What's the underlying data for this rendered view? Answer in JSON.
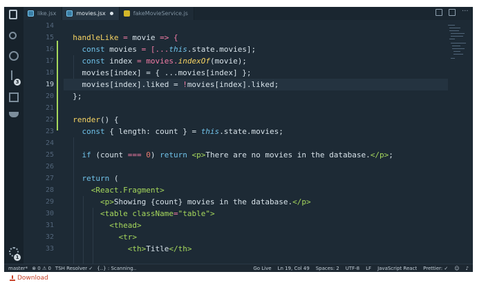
{
  "tabs": [
    {
      "label": "like.jsx",
      "icon": "react-icon"
    },
    {
      "label": "movies.jsx",
      "icon": "react-icon",
      "active": true,
      "modified": true
    },
    {
      "label": "fakeMovieService.js",
      "icon": "js-icon"
    }
  ],
  "activity_badges": {
    "git": "3",
    "settings": "1"
  },
  "lines": [
    {
      "n": "14",
      "cur": false,
      "seg": []
    },
    {
      "n": "15",
      "cur": false,
      "seg": [
        [
          "  handleLike",
          "fn"
        ],
        [
          " = ",
          "op"
        ],
        [
          "movie",
          "param"
        ],
        [
          " => {",
          "op"
        ]
      ]
    },
    {
      "n": "16",
      "cur": false,
      "seg": [
        [
          "    const ",
          "kw"
        ],
        [
          "movies",
          "var"
        ],
        [
          " = [...",
          "op"
        ],
        [
          "this",
          "this"
        ],
        [
          ".state.movies];",
          "var"
        ]
      ]
    },
    {
      "n": "17",
      "cur": false,
      "seg": [
        [
          "    const ",
          "kw"
        ],
        [
          "index",
          "var"
        ],
        [
          " = movies.",
          "op"
        ],
        [
          "indexOf",
          "fn"
        ],
        [
          "(movie);",
          "var"
        ]
      ]
    },
    {
      "n": "18",
      "cur": false,
      "seg": [
        [
          "    movies[index] = { ...movies[index] };",
          "var"
        ]
      ]
    },
    {
      "n": "19",
      "cur": true,
      "seg": [
        [
          "    movies[index].liked = ",
          "var"
        ],
        [
          "!",
          "op"
        ],
        [
          "movies[index].liked;",
          "var"
        ]
      ]
    },
    {
      "n": "20",
      "cur": false,
      "seg": [
        [
          "  };",
          "var"
        ]
      ]
    },
    {
      "n": "21",
      "cur": false,
      "seg": []
    },
    {
      "n": "22",
      "cur": false,
      "seg": [
        [
          "  render",
          "fn"
        ],
        [
          "() {",
          "var"
        ]
      ]
    },
    {
      "n": "23",
      "cur": false,
      "seg": [
        [
          "    const ",
          "kw"
        ],
        [
          "{ length: count } = ",
          "var"
        ],
        [
          "this",
          "this"
        ],
        [
          ".state.movies;",
          "var"
        ]
      ]
    },
    {
      "n": "24",
      "cur": false,
      "seg": []
    },
    {
      "n": "25",
      "cur": false,
      "seg": [
        [
          "    if ",
          "kw"
        ],
        [
          "(count ",
          "var"
        ],
        [
          "=== ",
          "op"
        ],
        [
          "0",
          "num"
        ],
        [
          ") ",
          "var"
        ],
        [
          "return ",
          "kw"
        ],
        [
          "<p>",
          "tag"
        ],
        [
          "There are no movies in the database.",
          "var"
        ],
        [
          "</p>",
          "tag"
        ],
        [
          ";",
          "var"
        ]
      ]
    },
    {
      "n": "26",
      "cur": false,
      "seg": []
    },
    {
      "n": "27",
      "cur": false,
      "seg": [
        [
          "    return ",
          "kw"
        ],
        [
          "(",
          "var"
        ]
      ]
    },
    {
      "n": "28",
      "cur": false,
      "seg": [
        [
          "      <React.Fragment>",
          "tag"
        ]
      ]
    },
    {
      "n": "29",
      "cur": false,
      "seg": [
        [
          "        <p>",
          "tag"
        ],
        [
          "Showing {count} movies in the database.",
          "var"
        ],
        [
          "</p>",
          "tag"
        ]
      ]
    },
    {
      "n": "30",
      "cur": false,
      "seg": [
        [
          "        <table ",
          "tag"
        ],
        [
          "className",
          "attr"
        ],
        [
          "=",
          "op"
        ],
        [
          "\"table\"",
          "str"
        ],
        [
          ">",
          "tag"
        ]
      ]
    },
    {
      "n": "31",
      "cur": false,
      "seg": [
        [
          "          <thead>",
          "tag"
        ]
      ]
    },
    {
      "n": "32",
      "cur": false,
      "seg": [
        [
          "            <tr>",
          "tag"
        ]
      ]
    },
    {
      "n": "33",
      "cur": false,
      "seg": [
        [
          "              <th>",
          "tag"
        ],
        [
          "Title",
          "var"
        ],
        [
          "</th>",
          "tag"
        ]
      ]
    }
  ],
  "syntax_colors": {
    "kw": "#6fc1e8",
    "fn": "#f7d463",
    "op": "#f07ba4",
    "param": "#d6e1e8",
    "var": "#d6e1e8",
    "this": "#6fc1e8",
    "num": "#e77b6f",
    "tag": "#a6d85c",
    "attr": "#a6d85c",
    "str": "#a6d85c"
  },
  "statusbar": {
    "branch": "master*",
    "problems": "⊗ 0 ⚠ 0",
    "resolver": "TSH Resolver ✓",
    "scanning": "{..} : Scanning..",
    "golive": "Go Live",
    "position": "Ln 19, Col 49",
    "spaces": "Spaces: 2",
    "encoding": "UTF-8",
    "eol": "LF",
    "language": "JavaScript React",
    "prettier": "Prettier: ✓"
  },
  "download_label": "Download"
}
